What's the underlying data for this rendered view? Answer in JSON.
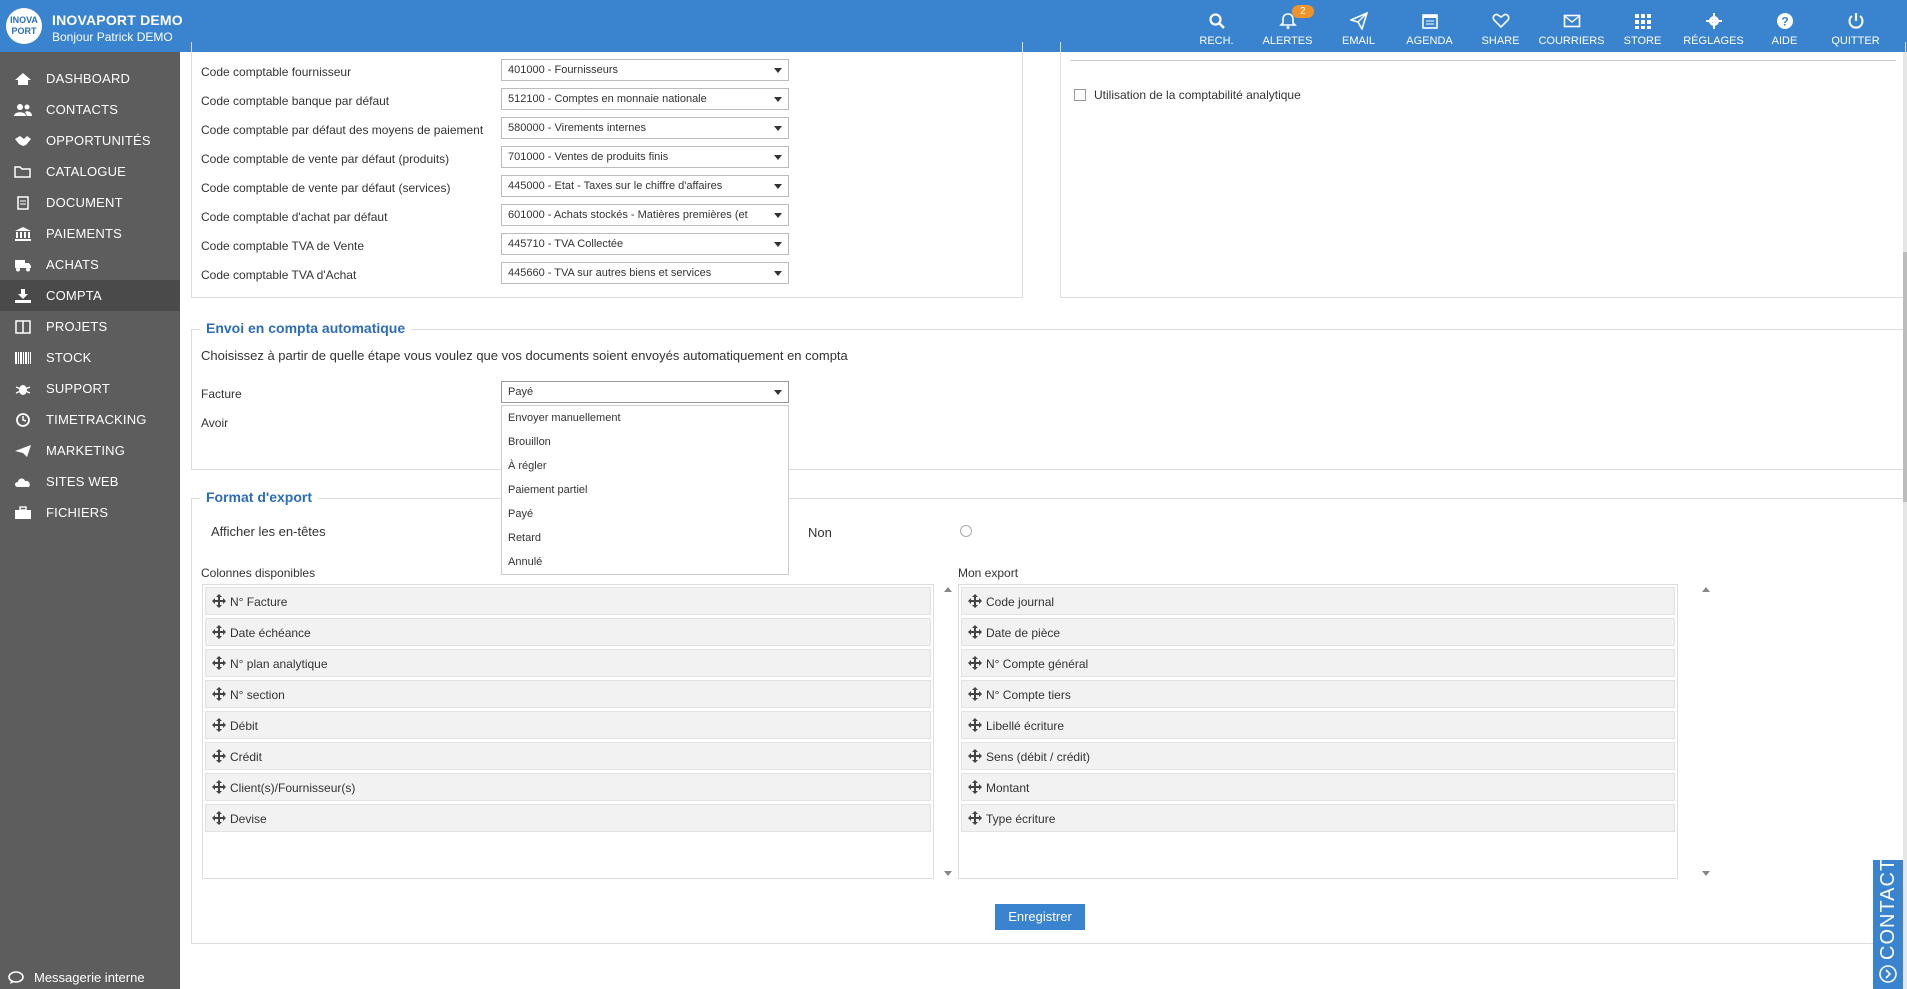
{
  "header": {
    "logo_text": "INOVA PORT",
    "app_name": "INOVAPORT DEMO",
    "greeting": "Bonjour Patrick DEMO",
    "nav": [
      {
        "label": "RECH.",
        "icon": "search-icon"
      },
      {
        "label": "ALERTES",
        "icon": "bell-icon",
        "badge": "2"
      },
      {
        "label": "EMAIL",
        "icon": "paper-plane-icon"
      },
      {
        "label": "AGENDA",
        "icon": "calendar-icon"
      },
      {
        "label": "SHARE",
        "icon": "heart-icon"
      },
      {
        "label": "COURRIERS",
        "icon": "envelope-icon"
      },
      {
        "label": "STORE",
        "icon": "grid-icon"
      },
      {
        "label": "RÉGLAGES",
        "icon": "gear-icon"
      },
      {
        "label": "AIDE",
        "icon": "question-icon"
      },
      {
        "label": "QUITTER",
        "icon": "power-icon"
      }
    ]
  },
  "sidebar": {
    "items": [
      {
        "label": "DASHBOARD",
        "icon": "home-icon"
      },
      {
        "label": "CONTACTS",
        "icon": "users-icon"
      },
      {
        "label": "OPPORTUNITÉS",
        "icon": "handshake-icon"
      },
      {
        "label": "CATALOGUE",
        "icon": "folder-icon"
      },
      {
        "label": "DOCUMENT",
        "icon": "document-icon"
      },
      {
        "label": "PAIEMENTS",
        "icon": "bank-icon"
      },
      {
        "label": "ACHATS",
        "icon": "truck-icon"
      },
      {
        "label": "COMPTA",
        "icon": "download-icon",
        "active": true
      },
      {
        "label": "PROJETS",
        "icon": "columns-icon"
      },
      {
        "label": "STOCK",
        "icon": "barcode-icon"
      },
      {
        "label": "SUPPORT",
        "icon": "bug-icon"
      },
      {
        "label": "TIMETRACKING",
        "icon": "clock-icon"
      },
      {
        "label": "MARKETING",
        "icon": "send-icon"
      },
      {
        "label": "SITES WEB",
        "icon": "cloud-icon"
      },
      {
        "label": "FICHIERS",
        "icon": "briefcase-icon"
      }
    ],
    "messaging": "Messagerie interne"
  },
  "accounting_codes": {
    "rows": [
      {
        "label": "Code comptable fournisseur",
        "value": "401000 - Fournisseurs"
      },
      {
        "label": "Code comptable banque par défaut",
        "value": "512100 - Comptes en monnaie nationale"
      },
      {
        "label": "Code comptable par défaut des moyens de paiement",
        "value": "580000 - Virements internes"
      },
      {
        "label": "Code comptable de vente par défaut (produits)",
        "value": "701000 - Ventes de produits finis"
      },
      {
        "label": "Code comptable de vente par défaut (services)",
        "value": "445000 - Etat - Taxes sur le chiffre d'affaires"
      },
      {
        "label": "Code comptable d'achat par défaut",
        "value": "601000 - Achats stockés - Matières premières (et"
      },
      {
        "label": "Code comptable TVA de Vente",
        "value": "445710 - TVA Collectée"
      },
      {
        "label": "Code comptable TVA d'Achat",
        "value": "445660 - TVA sur autres biens et services"
      }
    ],
    "analytic_checkbox_label": "Utilisation de la comptabilité analytique"
  },
  "auto_send": {
    "title": "Envoi en compta automatique",
    "description": "Choisissez à partir de quelle étape vous voulez que vos documents soient envoyés automatiquement en compta",
    "facture_label": "Facture",
    "facture_value": "Payé",
    "avoir_label": "Avoir",
    "dropdown_options": [
      "Envoyer manuellement",
      "Brouillon",
      "À régler",
      "Paiement partiel",
      "Payé",
      "Retard",
      "Annulé"
    ]
  },
  "export": {
    "title": "Format d'export",
    "headers_label": "Afficher les en-têtes",
    "no_label": "Non",
    "available_title": "Colonnes disponibles",
    "available": [
      "N° Facture",
      "Date échéance",
      "N° plan analytique",
      "N° section",
      "Débit",
      "Crédit",
      "Client(s)/Fournisseur(s)",
      "Devise"
    ],
    "mine_title": "Mon export",
    "mine": [
      "Code journal",
      "Date de pièce",
      "N° Compte général",
      "N° Compte tiers",
      "Libellé écriture",
      "Sens (débit / crédit)",
      "Montant",
      "Type écriture"
    ]
  },
  "save_label": "Enregistrer",
  "contact_tab": "CONTACT",
  "colors": {
    "primary": "#3a83cf",
    "sidebar": "#5d5d5d",
    "accent": "#f0932b",
    "title": "#2d6db5"
  }
}
